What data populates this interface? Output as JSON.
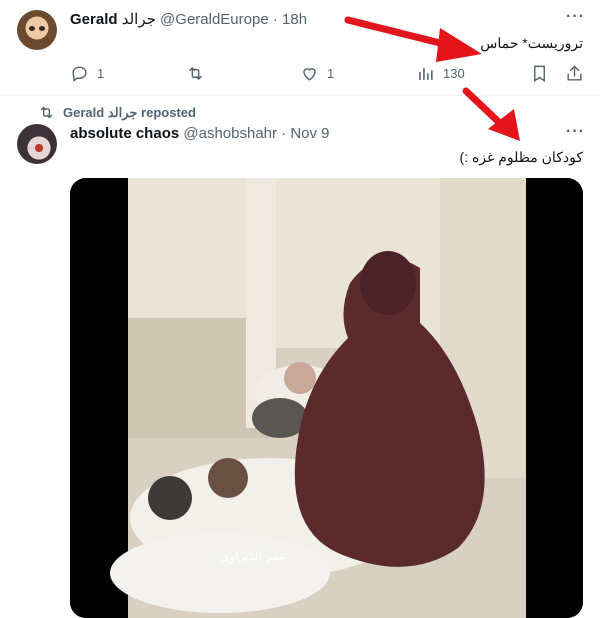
{
  "post1": {
    "display_name": "Gerald",
    "display_name_alt": "جرالد",
    "handle": "@GeraldEurope",
    "separator": "·",
    "time": "18h",
    "more": "···",
    "text": "تروریست* حماس",
    "replies": "1",
    "likes": "1",
    "views": "130"
  },
  "repost": {
    "label_name": "Gerald",
    "label_name_alt": "جرالد",
    "label_suffix": "reposted"
  },
  "post2": {
    "display_name": "absolute chaos",
    "handle": "@ashobshahr",
    "separator": "·",
    "time": "Nov 9",
    "more": "···",
    "text": "کودکان مظلوم غزه :)",
    "media_watermark": "عمر الدیراوی"
  },
  "colors": {
    "arrow": "#e4141b",
    "muted": "#536471",
    "text": "#0f1419",
    "divider": "#eff3f4"
  },
  "icons": [
    "reply-icon",
    "retweet-icon",
    "like-icon",
    "views-icon",
    "bookmark-icon",
    "share-icon",
    "repost-icon",
    "more-icon"
  ]
}
